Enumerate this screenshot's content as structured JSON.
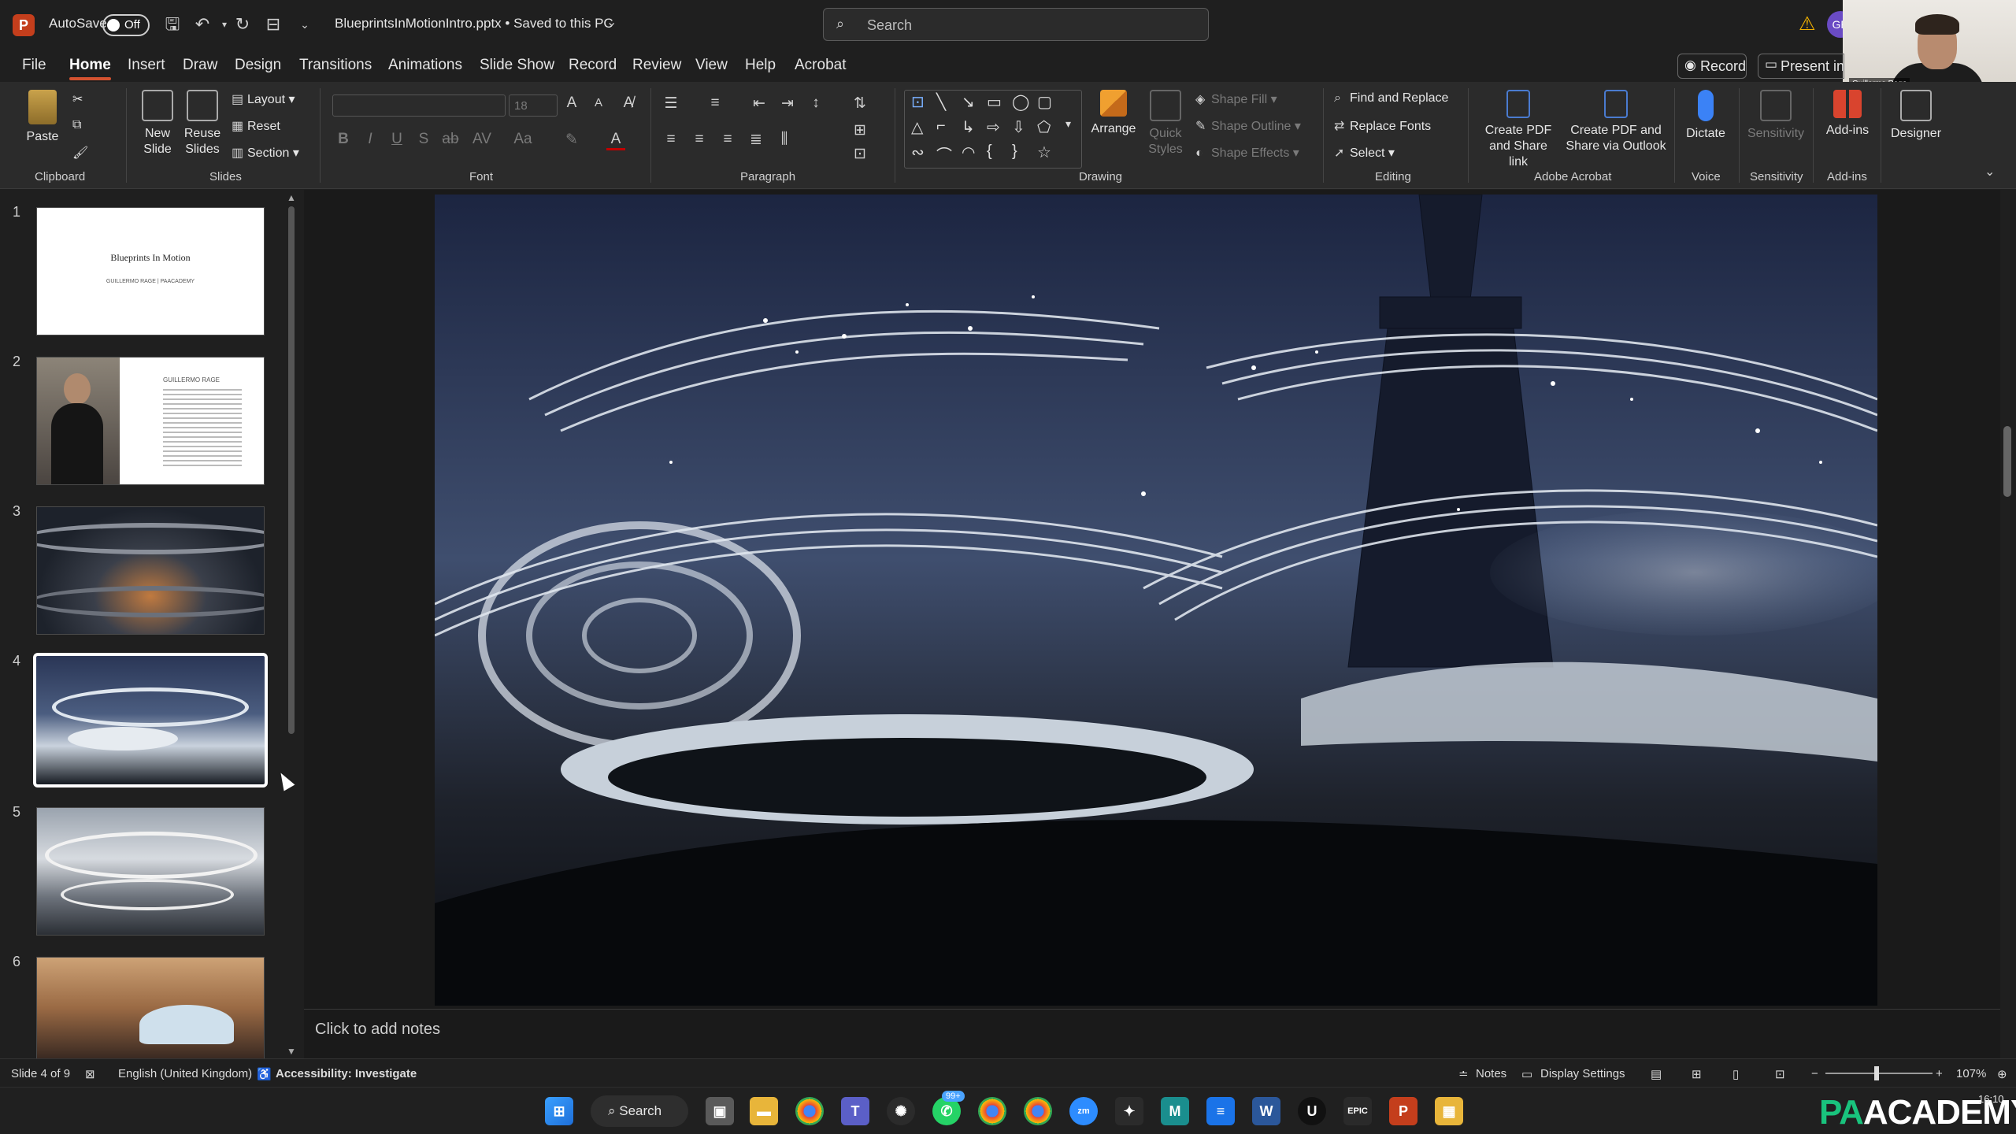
{
  "titlebar": {
    "autosave_label": "AutoSave",
    "autosave_state": "Off",
    "filename": "BlueprintsInMotionIntro.pptx • Saved to this PC",
    "search_placeholder": "Search",
    "account_initials": "GR"
  },
  "webcam": {
    "name": "Guillermo Rage"
  },
  "menu": {
    "items": [
      "File",
      "Home",
      "Insert",
      "Draw",
      "Design",
      "Transitions",
      "Animations",
      "Slide Show",
      "Record",
      "Review",
      "View",
      "Help",
      "Acrobat"
    ],
    "active": "Home",
    "record_button": "Record",
    "present_button": "Present in T"
  },
  "ribbon": {
    "clipboard": {
      "paste": "Paste",
      "label": "Clipboard"
    },
    "slides": {
      "new_slide": "New Slide",
      "reuse_slides": "Reuse Slides",
      "layout": "Layout",
      "reset": "Reset",
      "section": "Section",
      "label": "Slides"
    },
    "font": {
      "size": "18",
      "label": "Font"
    },
    "paragraph": {
      "label": "Paragraph"
    },
    "drawing": {
      "arrange": "Arrange",
      "quick_styles": "Quick Styles",
      "shape_fill": "Shape Fill",
      "shape_outline": "Shape Outline",
      "shape_effects": "Shape Effects",
      "label": "Drawing"
    },
    "editing": {
      "find_replace": "Find and Replace",
      "replace_fonts": "Replace Fonts",
      "select": "Select",
      "label": "Editing"
    },
    "acrobat": {
      "create_pdf_share": "Create PDF and Share link",
      "create_pdf_outlook": "Create PDF and Share via Outlook",
      "label": "Adobe Acrobat"
    },
    "voice": {
      "dictate": "Dictate",
      "label": "Voice"
    },
    "sensitivity": {
      "button": "Sensitivity",
      "label": "Sensitivity"
    },
    "addins": {
      "button": "Add-ins",
      "label": "Add-ins"
    },
    "designer": {
      "button": "Designer"
    }
  },
  "thumbnails": {
    "numbers": [
      "1",
      "2",
      "3",
      "4",
      "5",
      "6"
    ],
    "slide1_title": "Blueprints In Motion",
    "slide1_sub": "GUILLERMO RAGE | PAACADEMY",
    "slide2_name": "GUILLERMO RAGE",
    "selected": 4
  },
  "editor": {
    "notes_placeholder": "Click to add notes"
  },
  "statusbar": {
    "slide_info": "Slide 4 of 9",
    "language": "English (United Kingdom)",
    "accessibility": "Accessibility: Investigate",
    "notes": "Notes",
    "display_settings": "Display Settings",
    "zoom": "107%"
  },
  "taskbar": {
    "search_label": "Search",
    "whatsapp_badge": "99+",
    "brand_pa": "PA",
    "brand_rest": "ACADEMY",
    "time": "16:10"
  }
}
